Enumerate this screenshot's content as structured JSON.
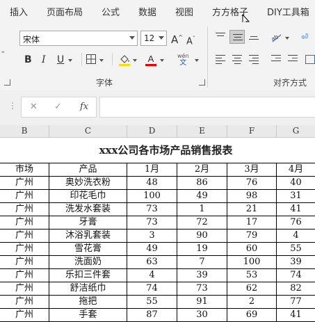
{
  "ribbon_tabs": [
    "插入",
    "页面布局",
    "公式",
    "数据",
    "视图",
    "方方格子",
    "DIY工具箱"
  ],
  "font": {
    "name": "宋体",
    "size": "12",
    "bold": "B",
    "italic": "I",
    "underline": "U",
    "grow": "A",
    "shrink": "A",
    "wen": "wén",
    "wen_char": "文",
    "group_label": "字体",
    "fill_color": "#f7e000",
    "font_color": "#e00000"
  },
  "alignment": {
    "group_label": "对齐方式"
  },
  "formula_bar": {
    "cancel": "✕",
    "enter": "✓",
    "fx": "fx",
    "handle": "⋮",
    "value": ""
  },
  "columns": [
    "B",
    "C",
    "D",
    "E",
    "F",
    "G"
  ],
  "sheet": {
    "title": "xxx公司各市场产品销售报表",
    "headers": [
      "市场",
      "产品",
      "1月",
      "2月",
      "3月",
      "4月"
    ],
    "rows": [
      [
        "广州",
        "奥妙洗衣粉",
        "48",
        "86",
        "76",
        "40"
      ],
      [
        "广州",
        "印花毛巾",
        "100",
        "49",
        "98",
        "31"
      ],
      [
        "广州",
        "洗发水套装",
        "73",
        "1",
        "21",
        "41"
      ],
      [
        "广州",
        "牙膏",
        "73",
        "72",
        "17",
        "76"
      ],
      [
        "广州",
        "沐浴乳套装",
        "3",
        "90",
        "79",
        "4"
      ],
      [
        "广州",
        "雪花膏",
        "49",
        "19",
        "60",
        "55"
      ],
      [
        "广州",
        "洗面奶",
        "63",
        "7",
        "100",
        "39"
      ],
      [
        "广州",
        "乐扣三件套",
        "4",
        "39",
        "53",
        "74"
      ],
      [
        "广州",
        "舒洁纸巾",
        "74",
        "73",
        "62",
        "82"
      ],
      [
        "广州",
        "拖把",
        "55",
        "91",
        "2",
        "77"
      ],
      [
        "广州",
        "手套",
        "87",
        "30",
        "69",
        "41"
      ]
    ]
  }
}
